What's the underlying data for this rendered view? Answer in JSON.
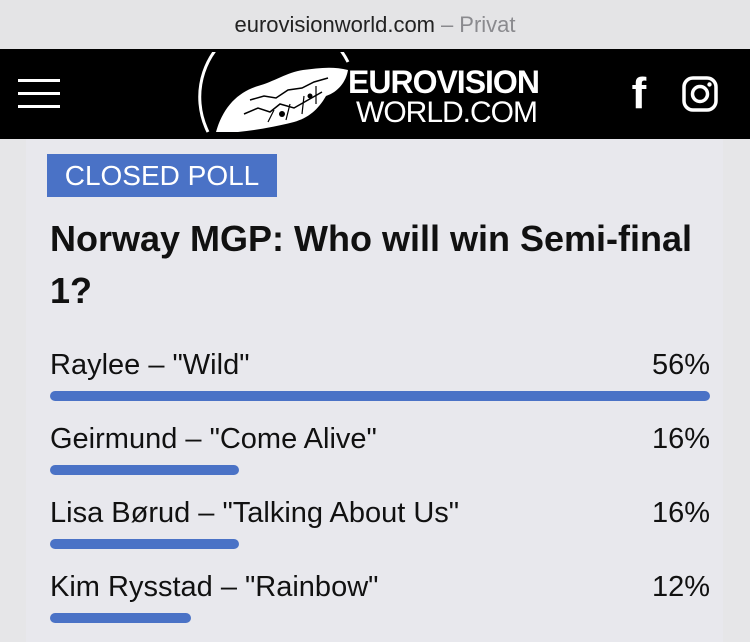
{
  "browser": {
    "domain": "eurovisionworld.com",
    "mode": "Privat"
  },
  "header": {
    "logo_line1": "EUROVISION",
    "logo_line2": "WORLD.COM",
    "menu_icon": "hamburger-menu-icon",
    "social_icons": [
      "facebook-icon",
      "instagram-icon"
    ]
  },
  "poll": {
    "status": "CLOSED POLL",
    "title": "Norway MGP: Who will win Semi-final 1?",
    "accent_color": "#4a72c6",
    "options": [
      {
        "label": "Raylee – \"Wild\"",
        "percent": "56%",
        "fraction": 0.56
      },
      {
        "label": "Geirmund – \"Come Alive\"",
        "percent": "16%",
        "fraction": 0.16
      },
      {
        "label": "Lisa Børud – \"Talking About Us\"",
        "percent": "16%",
        "fraction": 0.16
      },
      {
        "label": "Kim Rysstad – \"Rainbow\"",
        "percent": "12%",
        "fraction": 0.12
      }
    ]
  }
}
